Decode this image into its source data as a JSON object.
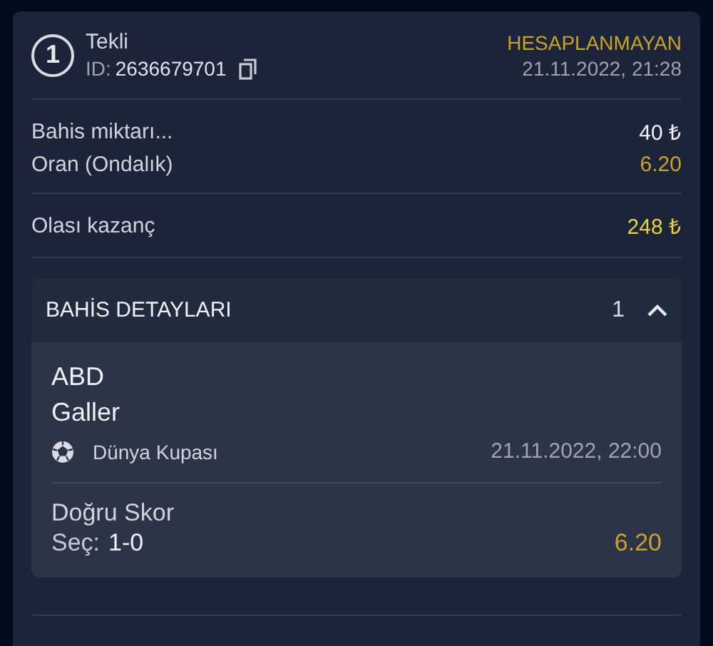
{
  "bet": {
    "number": "1",
    "type": "Tekli",
    "id_label": "ID:",
    "id": "2636679701",
    "status": "HESAPLANMAYAN",
    "placed_at": "21.11.2022, 21:28"
  },
  "summary": [
    {
      "label": "Bahis miktarı...",
      "value": "40 ₺",
      "kind": "amount"
    },
    {
      "label": "Oran (Ondalık)",
      "value": "6.20",
      "kind": "odds"
    }
  ],
  "payout": {
    "label": "Olası kazanç",
    "value": "248 ₺"
  },
  "details": {
    "title": "BAHİS DETAYLARI",
    "count": "1",
    "expanded": true,
    "selections": [
      {
        "home": "ABD",
        "away": "Galler",
        "competition": "Dünya Kupası",
        "start": "21.11.2022, 22:00",
        "market": "Doğru Skor",
        "pick_label": "Seç:",
        "pick": "1-0",
        "odds": "6.20"
      }
    ]
  }
}
